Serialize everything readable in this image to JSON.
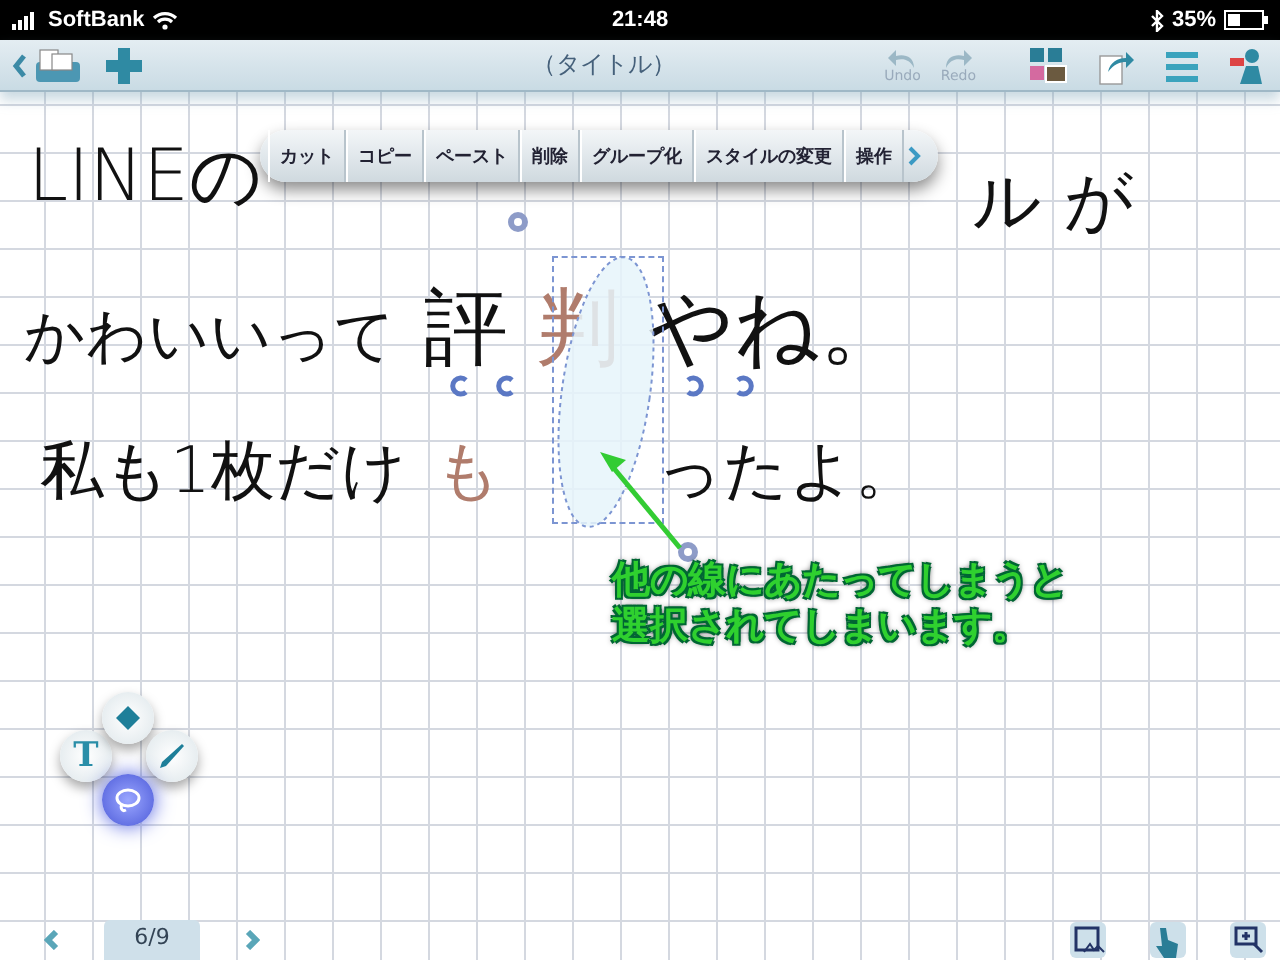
{
  "status_bar": {
    "carrier": "SoftBank",
    "time": "21:48",
    "battery": "35%"
  },
  "toolbar": {
    "title": "（タイトル）",
    "undo": "Undo",
    "redo": "Redo"
  },
  "edit_menu": {
    "items": [
      "カット",
      "コピー",
      "ペースト",
      "削除",
      "グループ化",
      "スタイルの変更",
      "操作"
    ]
  },
  "handwriting": [
    {
      "segments": [
        {
          "text": "LINEの",
          "selected": false
        }
      ]
    },
    {
      "segments": [
        {
          "text": "ル が",
          "selected": false
        }
      ]
    },
    {
      "segments": [
        {
          "text": "かわいいって",
          "selected": false
        },
        {
          "text": "評",
          "selected": false
        },
        {
          "text": "判",
          "selected": true
        },
        {
          "text": "やね。",
          "selected": false
        }
      ]
    },
    {
      "segments": [
        {
          "text": "私も1枚だけ",
          "selected": false
        },
        {
          "text": "も",
          "selected": true
        },
        {
          "text": "ったよ。",
          "selected": false
        }
      ]
    }
  ],
  "callout": {
    "lines": [
      "他の線にあたってしまうと",
      "選択されてしまいます。"
    ]
  },
  "tools": [
    {
      "kind": "text",
      "label": "T",
      "selected": false
    },
    {
      "kind": "shape",
      "selected": false
    },
    {
      "kind": "pen",
      "selected": false
    },
    {
      "kind": "lasso",
      "selected": true
    }
  ],
  "pager": {
    "page": "6/9"
  }
}
